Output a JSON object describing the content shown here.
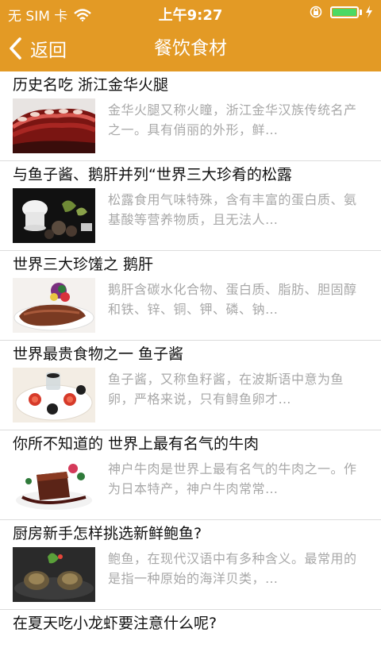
{
  "status": {
    "carrier": "无 SIM 卡",
    "time": "上午9:27",
    "battery_level": 1.0,
    "battery_color": "#4cd964"
  },
  "nav": {
    "back_label": "返回",
    "title": "餐饮食材",
    "bar_color": "#e39a25"
  },
  "items": [
    {
      "title": "历史名吃 浙江金华火腿",
      "summary": "金华火腿又称火瞳，浙江金华汉族传统名产之一。具有俏丽的外形，鲜…"
    },
    {
      "title": "与鱼子酱、鹅肝并列“世界三大珍肴的松露",
      "summary": "松露食用气味特殊，含有丰富的蛋白质、氨基酸等营养物质，且无法人…"
    },
    {
      "title": "世界三大珍馐之 鹅肝",
      "summary": "鹅肝含碳水化合物、蛋白质、脂肪、胆固醇和铁、锌、铜、钾、磷、钠…"
    },
    {
      "title": "世界最贵食物之一 鱼子酱",
      "summary": "鱼子酱，又称鱼籽酱，在波斯语中意为鱼卵，严格来说，只有鲟鱼卵才…"
    },
    {
      "title": "你所不知道的 世界上最有名气的牛肉",
      "summary": "神户牛肉是世界上最有名气的牛肉之一。作为日本特产，神户牛肉常常…"
    },
    {
      "title": "厨房新手怎样挑选新鲜鲍鱼?",
      "summary": "鲍鱼，在现代汉语中有多种含义。最常用的是指一种原始的海洋贝类，…"
    },
    {
      "title": "在夏天吃小龙虾要注意什么呢?"
    }
  ]
}
